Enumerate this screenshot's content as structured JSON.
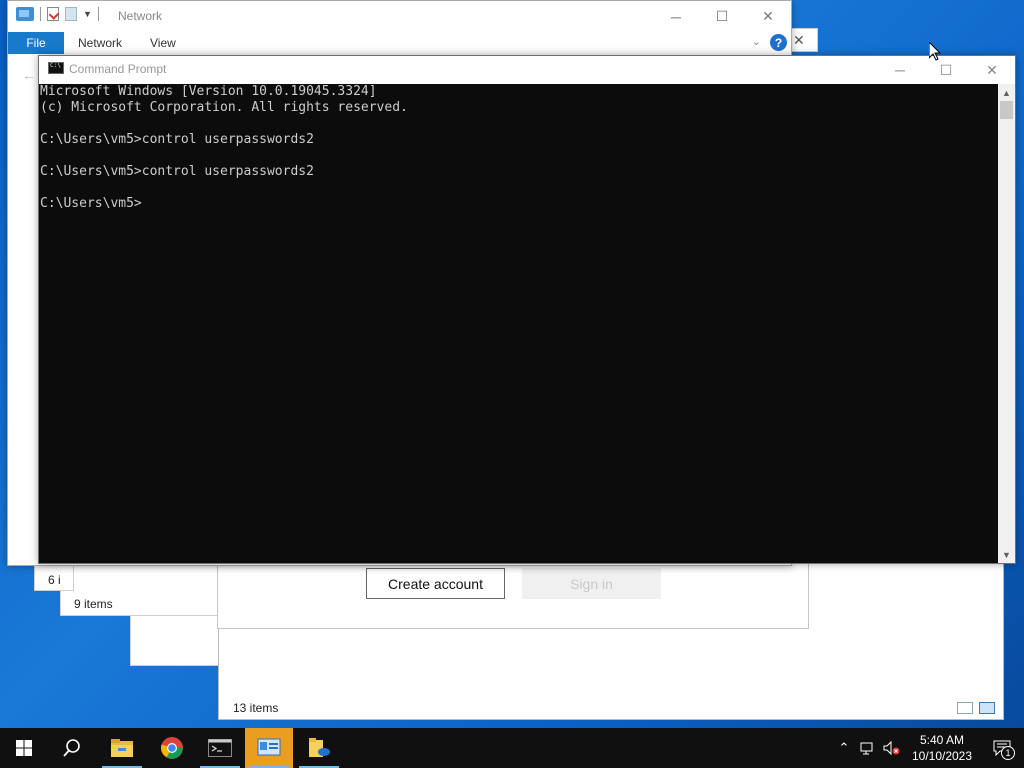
{
  "explorer": {
    "title": "Network",
    "tabs": {
      "file": "File",
      "network": "Network",
      "view": "View"
    },
    "help": "?"
  },
  "cmd": {
    "title": "Command Prompt",
    "lines": [
      "Microsoft Windows [Version 10.0.19045.3324]",
      "(c) Microsoft Corporation. All rights reserved.",
      "",
      "C:\\Users\\vm5>control userpasswords2",
      "",
      "C:\\Users\\vm5>control userpasswords2",
      "",
      "C:\\Users\\vm5>"
    ]
  },
  "account_dialog": {
    "create_account": "Create account",
    "sign_in": "Sign in"
  },
  "back_windows": {
    "status_6": "6 i",
    "status_9": "9 items",
    "status_13": "13 items"
  },
  "taskbar": {
    "apps": [
      "start-icon",
      "search-icon",
      "file-explorer-icon",
      "chrome-icon",
      "command-prompt-icon",
      "control-panel-icon",
      "onedrive-folder-icon"
    ],
    "clock_time": "5:40 AM",
    "clock_date": "10/10/2023",
    "notification_count": "1"
  },
  "colors": {
    "accent": "#1979ca",
    "taskbar_active": "#76b9ed",
    "highlight": "#ea9d20"
  }
}
